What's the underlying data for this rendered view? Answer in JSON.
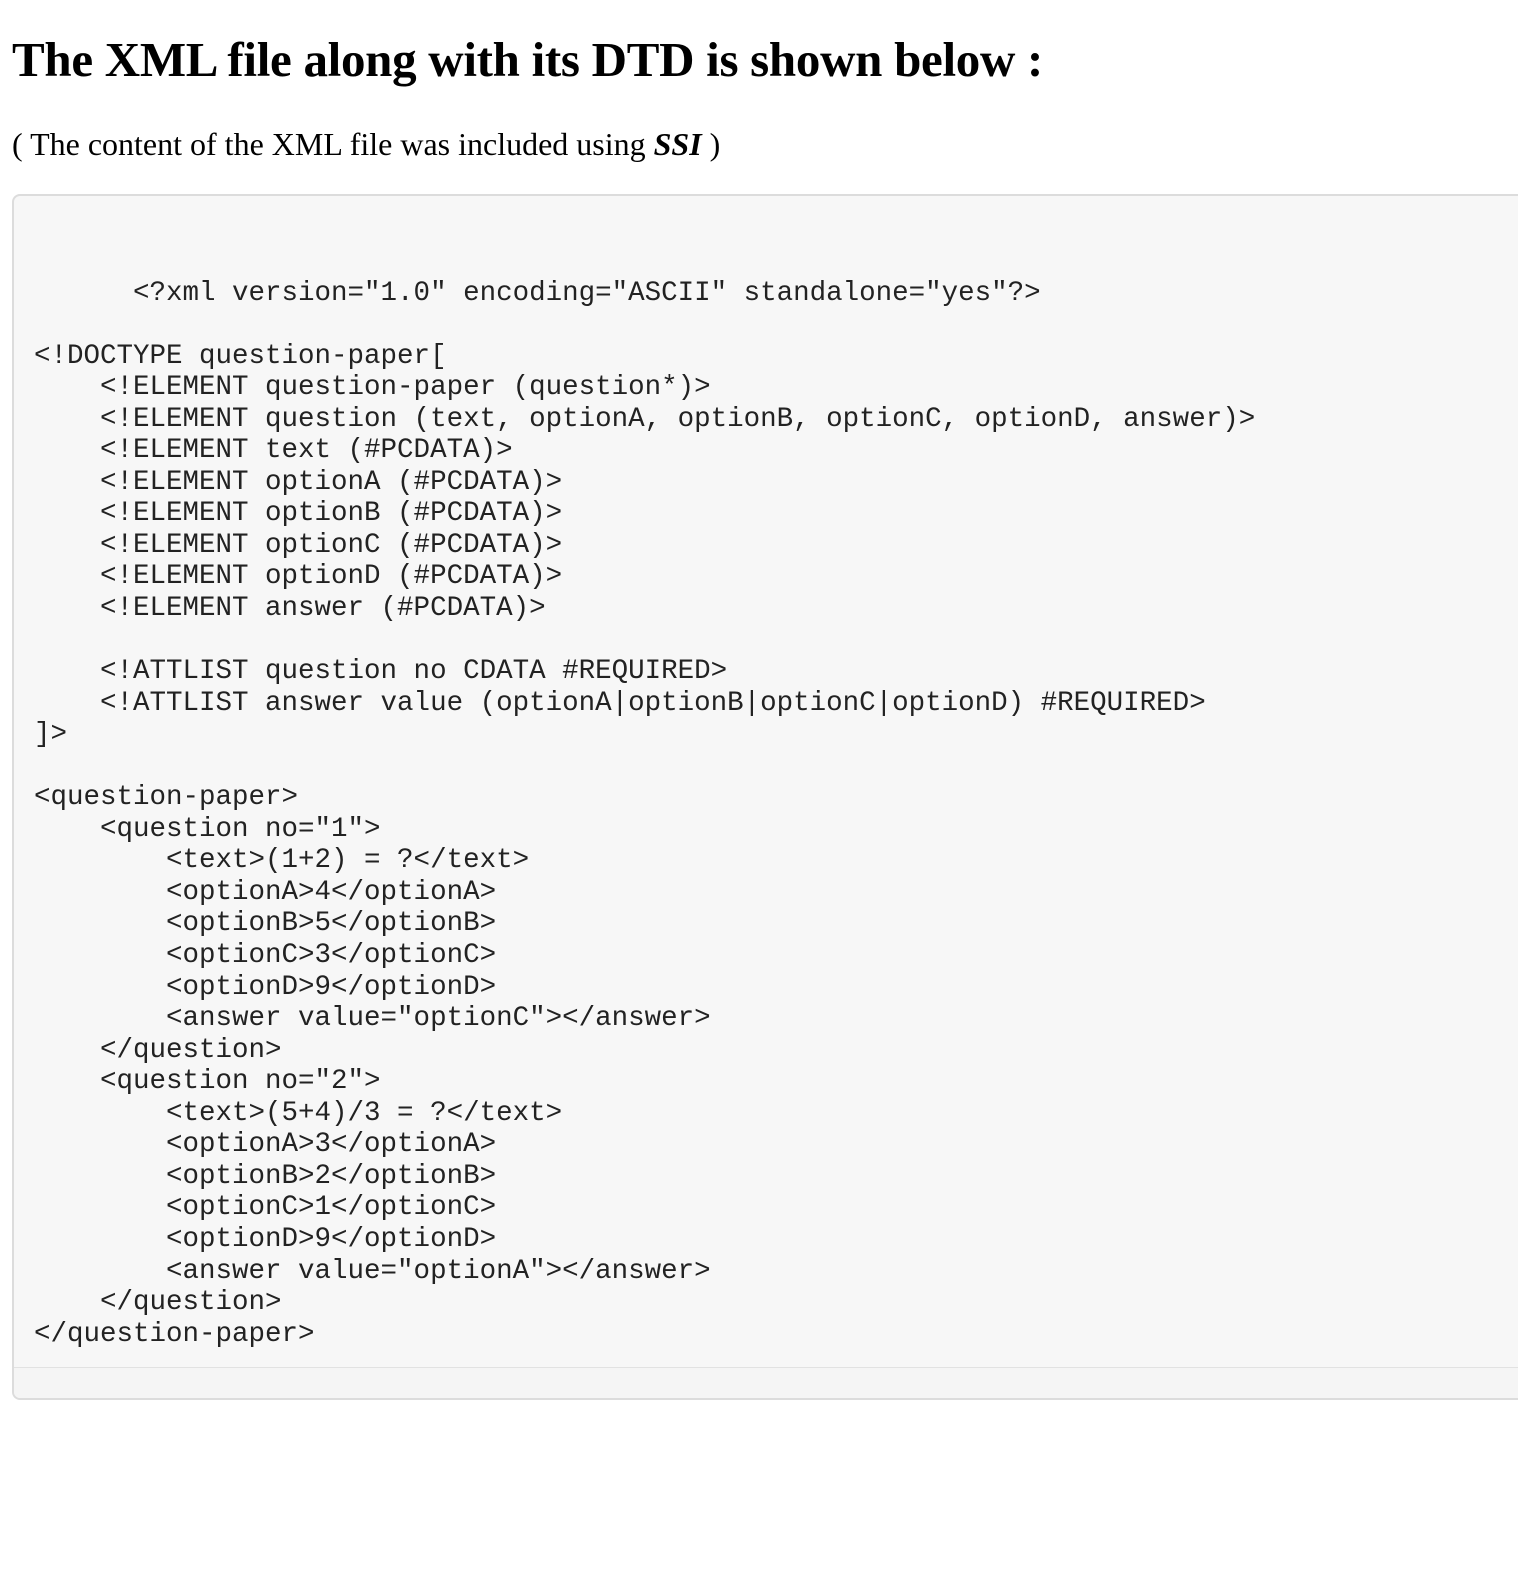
{
  "heading": "The XML file along with its DTD is shown below :",
  "subtitle": {
    "before": "( The content of the XML file was included using ",
    "emphasis": "SSI",
    "after": " )"
  },
  "code_lines": [
    "",
    "      <?xml version=\"1.0\" encoding=\"ASCII\" standalone=\"yes\"?>",
    "",
    "<!DOCTYPE question-paper[",
    "    <!ELEMENT question-paper (question*)>",
    "    <!ELEMENT question (text, optionA, optionB, optionC, optionD, answer)>",
    "    <!ELEMENT text (#PCDATA)>",
    "    <!ELEMENT optionA (#PCDATA)>",
    "    <!ELEMENT optionB (#PCDATA)>",
    "    <!ELEMENT optionC (#PCDATA)>",
    "    <!ELEMENT optionD (#PCDATA)>",
    "    <!ELEMENT answer (#PCDATA)>",
    "",
    "    <!ATTLIST question no CDATA #REQUIRED>",
    "    <!ATTLIST answer value (optionA|optionB|optionC|optionD) #REQUIRED>",
    "]>",
    "",
    "<question-paper>",
    "    <question no=\"1\">",
    "        <text>(1+2) = ?</text>",
    "        <optionA>4</optionA>",
    "        <optionB>5</optionB>",
    "        <optionC>3</optionC>",
    "        <optionD>9</optionD>",
    "        <answer value=\"optionC\"></answer>",
    "    </question>",
    "    <question no=\"2\">",
    "        <text>(5+4)/3 = ?</text>",
    "        <optionA>3</optionA>",
    "        <optionB>2</optionB>",
    "        <optionC>1</optionC>",
    "        <optionD>9</optionD>",
    "        <answer value=\"optionA\"></answer>",
    "    </question>",
    "</question-paper>"
  ]
}
